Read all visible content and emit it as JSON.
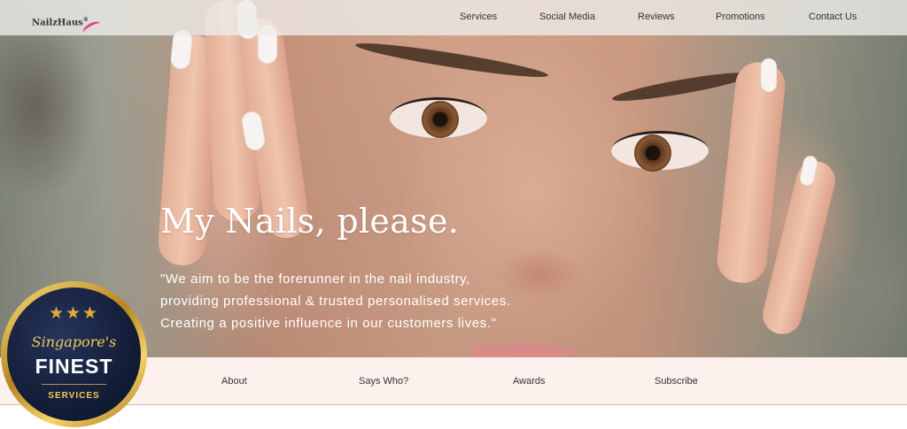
{
  "brand": {
    "logo_text": "NailzHaus",
    "logo_mark": "®",
    "accent": "#e83f8a"
  },
  "nav": {
    "items": [
      "Services",
      "Social Media",
      "Reviews",
      "Promotions",
      "Contact Us"
    ]
  },
  "hero": {
    "title": "My Nails, please.",
    "quote_lines": [
      "\"We aim to be the forerunner in the nail industry,",
      "providing professional & trusted personalised services.",
      "Creating a positive influence in our customers lives.\""
    ],
    "image_icon": "face-hands-photo"
  },
  "subnav": {
    "items": [
      "About",
      "Says Who?",
      "Awards",
      "Subscribe"
    ],
    "background": "#fdf1ee"
  },
  "badge": {
    "stars": "★★★",
    "line1": "Singapore's",
    "line2": "FINEST",
    "line3": "SERVICES"
  }
}
